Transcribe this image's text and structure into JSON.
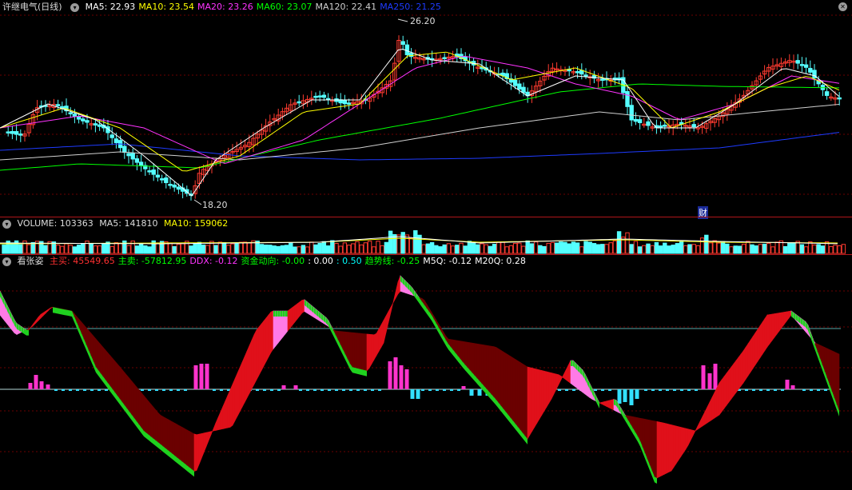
{
  "colors": {
    "ma5": "#ffffff",
    "ma10": "#ffff00",
    "ma20": "#ff33ff",
    "ma60": "#00ff00",
    "ma120": "#cfcfcf",
    "ma250": "#1e3bff",
    "up": "#ff3b30",
    "down": "#55ffff",
    "grid": "#6b0000"
  },
  "price_pane": {
    "title": "许继电气(日线)",
    "ma": [
      {
        "label": "MA5:",
        "value": "22.93",
        "color": "#ffffff"
      },
      {
        "label": "MA10:",
        "value": "23.54",
        "color": "#ffff00"
      },
      {
        "label": "MA20:",
        "value": "23.26",
        "color": "#ff33ff"
      },
      {
        "label": "MA60:",
        "value": "23.07",
        "color": "#00ff00"
      },
      {
        "label": "MA120:",
        "value": "22.41",
        "color": "#cfcfcf"
      },
      {
        "label": "MA250:",
        "value": "21.25",
        "color": "#1e3bff"
      }
    ],
    "high_mark": "26.20",
    "low_mark": "18.20",
    "event_badge": "财",
    "toggle_icon": "chevron-down-icon",
    "close_icon": "close-icon"
  },
  "volume_pane": {
    "label": "VOLUME: 103363",
    "ma5": "MA5: 141810",
    "ma10": "MA10: 159062"
  },
  "indicator_pane": {
    "name": "看张姿",
    "items": [
      {
        "label": "主买: 45549.65",
        "color": "#ff3030"
      },
      {
        "label": "主卖: -57812.95",
        "color": "#00ff00"
      },
      {
        "label": "DDX: -0.12",
        "color": "#ff33ff"
      },
      {
        "label": "资金动向: -0.00",
        "color": "#00ff00"
      },
      {
        "label": ": 0.00",
        "color": "#ffffff"
      },
      {
        "label": ": 0.50",
        "color": "#00ffff"
      },
      {
        "label": "趋势线: -0.25",
        "color": "#00ff00"
      },
      {
        "label": "M5Q: -0.12",
        "color": "#ffffff"
      },
      {
        "label": "M20Q: 0.28",
        "color": "#ffffff"
      }
    ]
  }
}
